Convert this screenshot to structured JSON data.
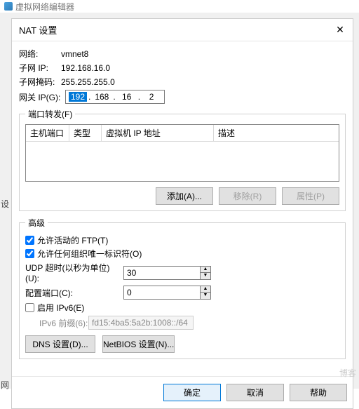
{
  "app": {
    "title": "虚拟网络编辑器"
  },
  "dialog": {
    "title": "NAT 设置"
  },
  "info": {
    "net_label": "网络:",
    "net_value": "vmnet8",
    "subnet_label": "子网 IP:",
    "subnet_value": "192.168.16.0",
    "mask_label": "子网掩码:",
    "mask_value": "255.255.255.0",
    "gw_label": "网关 IP(G):",
    "gw_oct1": "192",
    "gw_oct2": "168",
    "gw_oct3": "16",
    "gw_oct4": "2"
  },
  "portfwd": {
    "legend": "端口转发(F)",
    "col_hostport": "主机端口",
    "col_type": "类型",
    "col_vmip": "虚拟机 IP 地址",
    "col_desc": "描述",
    "add": "添加(A)...",
    "remove": "移除(R)",
    "props": "属性(P)"
  },
  "adv": {
    "legend": "高级",
    "ftp": "允许活动的 FTP(T)",
    "oui": "允许任何组织唯一标识符(O)",
    "udp_label": "UDP 超时(以秒为单位)(U):",
    "udp_value": "30",
    "cfgport_label": "配置端口(C):",
    "cfgport_value": "0",
    "ipv6": "启用 IPv6(E)",
    "prefix_label": "IPv6 前缀(6):",
    "prefix_value": "fd15:4ba5:5a2b:1008::/64",
    "dns": "DNS 设置(D)...",
    "netbios": "NetBIOS 设置(N)..."
  },
  "footer": {
    "ok": "确定",
    "cancel": "取消",
    "help": "帮助"
  },
  "outer": {
    "left": "设",
    "bot": "网"
  },
  "watermark": "博客"
}
